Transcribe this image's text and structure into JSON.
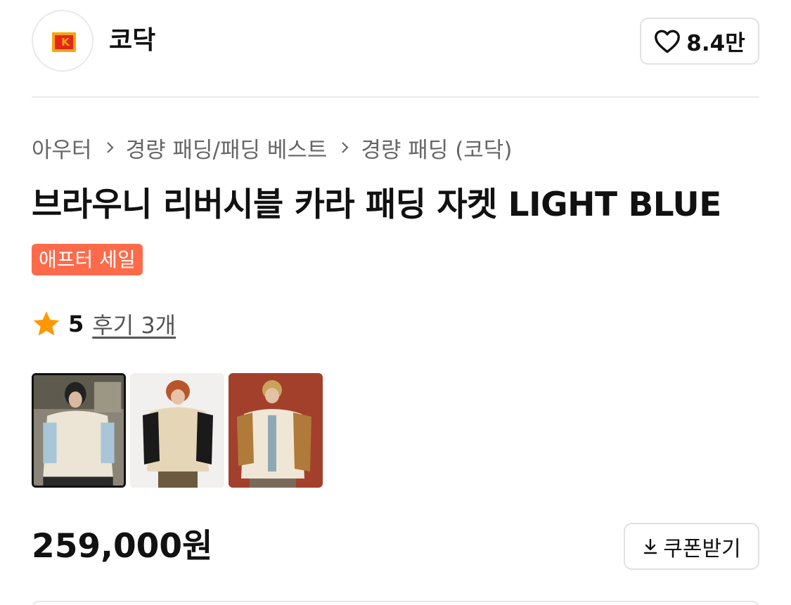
{
  "brand": {
    "name": "코닥",
    "logo_letter": "K",
    "like_count": "8.4만"
  },
  "breadcrumb": [
    "아우터",
    "경량 패딩/패딩 베스트",
    "경량 패딩 (코닥)"
  ],
  "product": {
    "title": "브라우니 리버시블 카라 패딩 자켓 LIGHT BLUE",
    "badge": "애프터 세일",
    "rating": "5",
    "review_link": "후기 3개",
    "price": "259,000원"
  },
  "thumbnails": [
    {
      "icon": "product-photo-light-blue-jacket",
      "selected": true
    },
    {
      "icon": "product-photo-black-jacket",
      "selected": false
    },
    {
      "icon": "product-photo-brown-jacket",
      "selected": false
    }
  ],
  "coupon": {
    "label": "쿠폰받기"
  },
  "colors": {
    "badge": "#ff6b4a",
    "star": "#ff9800",
    "kodak_yellow": "#f5a70a",
    "kodak_red": "#e4261c"
  }
}
